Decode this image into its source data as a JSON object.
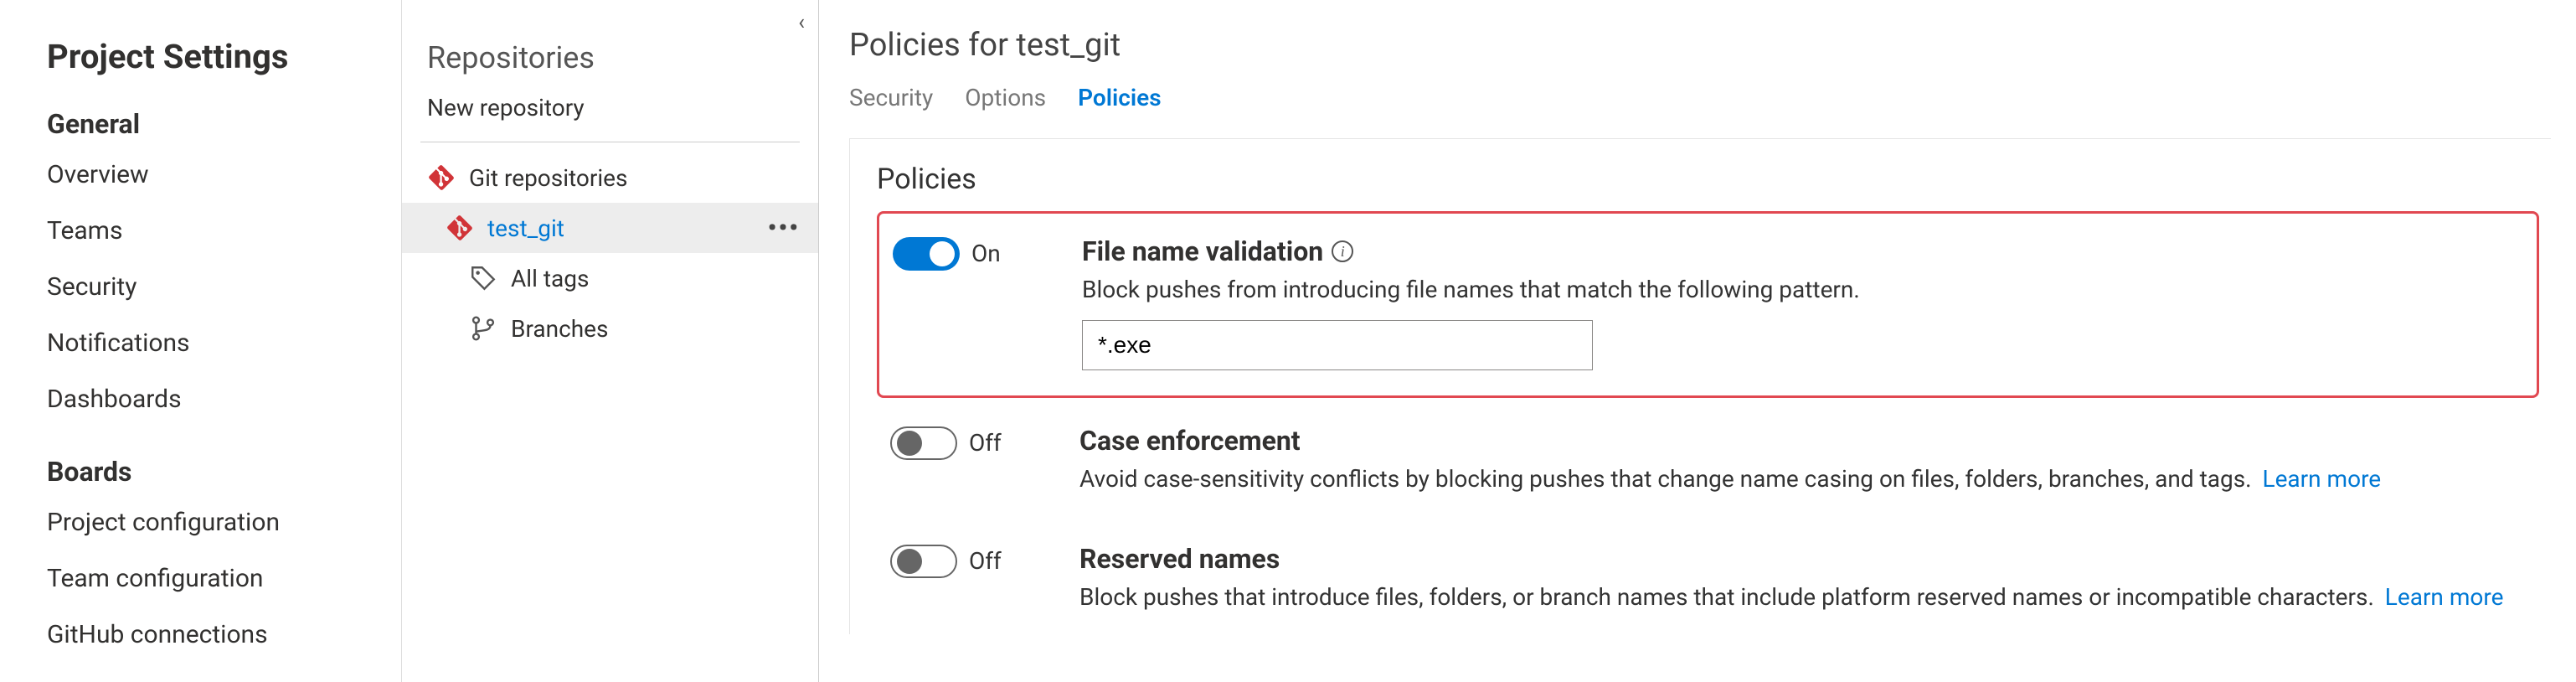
{
  "settings": {
    "title": "Project Settings",
    "sections": [
      {
        "header": "General",
        "items": [
          "Overview",
          "Teams",
          "Security",
          "Notifications",
          "Dashboards"
        ]
      },
      {
        "header": "Boards",
        "items": [
          "Project configuration",
          "Team configuration",
          "GitHub connections"
        ]
      }
    ]
  },
  "repos": {
    "title": "Repositories",
    "new_label": "New repository",
    "tree": {
      "root_label": "Git repositories",
      "selected_label": "test_git",
      "child_tags_label": "All tags",
      "child_branches_label": "Branches",
      "more_glyph": "•••"
    }
  },
  "main": {
    "title": "Policies for test_git",
    "tabs": {
      "security": "Security",
      "options": "Options",
      "policies": "Policies"
    },
    "active_tab": "policies",
    "panel_heading": "Policies",
    "toggle_on_label": "On",
    "toggle_off_label": "Off",
    "learn_more_label": "Learn more",
    "policies": [
      {
        "key": "file_name_validation",
        "enabled": true,
        "highlighted": true,
        "title": "File name validation",
        "has_info": true,
        "desc": "Block pushes from introducing file names that match the following pattern.",
        "input_value": "*.exe"
      },
      {
        "key": "case_enforcement",
        "enabled": false,
        "highlighted": false,
        "title": "Case enforcement",
        "has_info": false,
        "desc": "Avoid case-sensitivity conflicts by blocking pushes that change name casing on files, folders, branches, and tags.",
        "learn_more": true
      },
      {
        "key": "reserved_names",
        "enabled": false,
        "highlighted": false,
        "title": "Reserved names",
        "has_info": false,
        "desc": "Block pushes that introduce files, folders, or branch names that include platform reserved names or incompatible characters.",
        "learn_more": true
      }
    ]
  }
}
